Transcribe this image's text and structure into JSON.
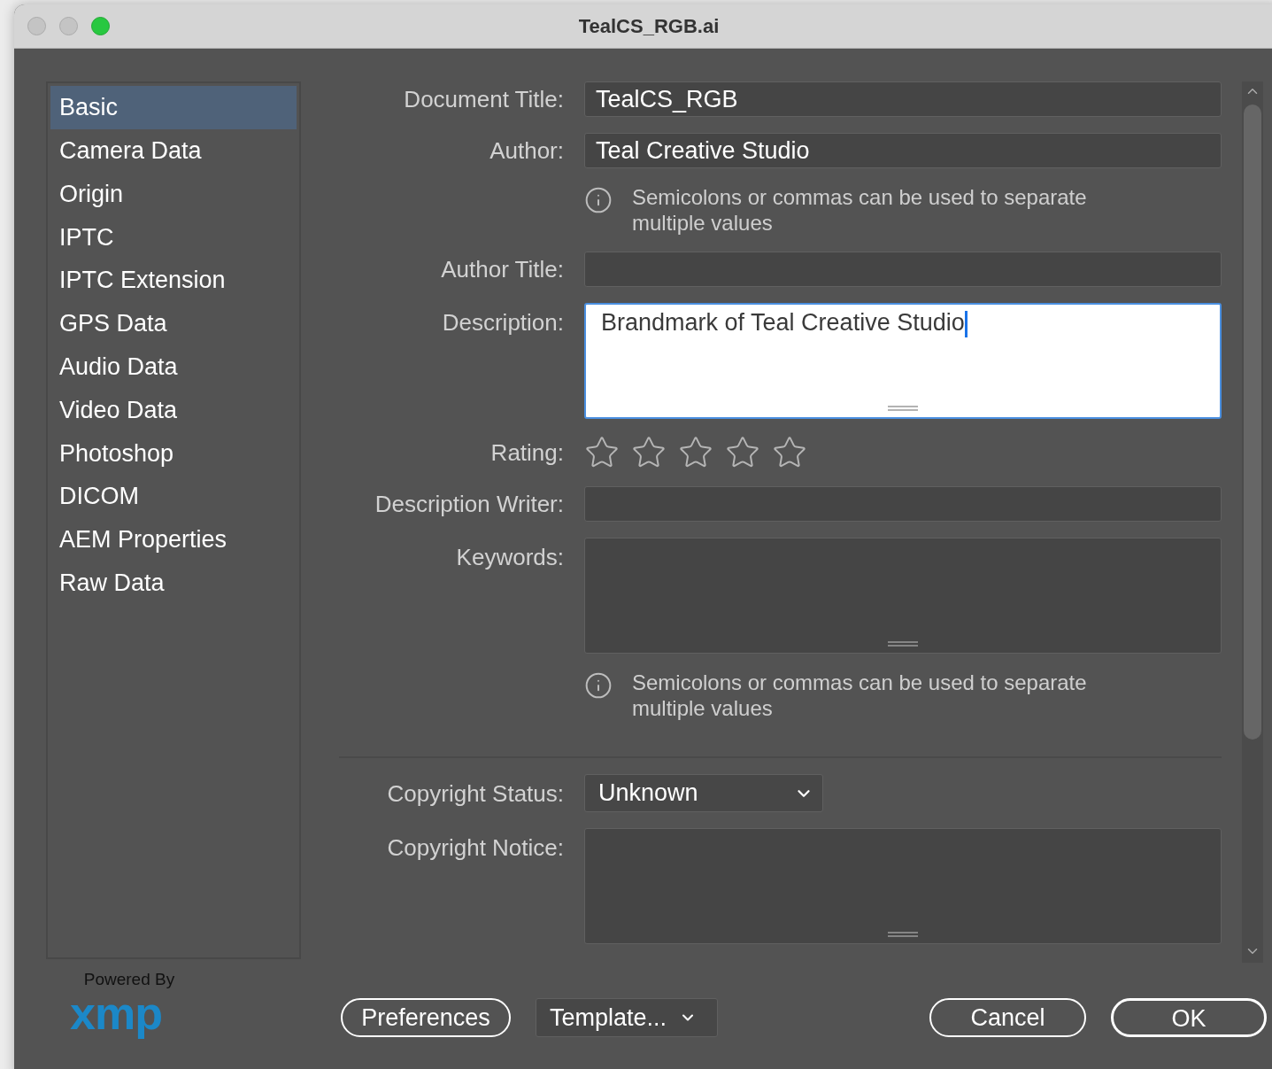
{
  "window": {
    "title": "TealCS_RGB.ai"
  },
  "sidebar": {
    "items": [
      {
        "label": "Basic",
        "selected": true
      },
      {
        "label": "Camera Data",
        "selected": false
      },
      {
        "label": "Origin",
        "selected": false
      },
      {
        "label": "IPTC",
        "selected": false
      },
      {
        "label": "IPTC Extension",
        "selected": false
      },
      {
        "label": "GPS Data",
        "selected": false
      },
      {
        "label": "Audio Data",
        "selected": false
      },
      {
        "label": "Video Data",
        "selected": false
      },
      {
        "label": "Photoshop",
        "selected": false
      },
      {
        "label": "DICOM",
        "selected": false
      },
      {
        "label": "AEM Properties",
        "selected": false
      },
      {
        "label": "Raw Data",
        "selected": false
      }
    ]
  },
  "sections": [
    {
      "fields": [
        {
          "kind": "text",
          "label": "Document Title:",
          "value": "TealCS_RGB"
        },
        {
          "kind": "text",
          "label": "Author:",
          "value": "Teal Creative Studio"
        },
        {
          "kind": "note",
          "text": "Semicolons or commas can be used to separate multiple values"
        },
        {
          "kind": "text",
          "label": "Author Title:"
        },
        {
          "kind": "textarea",
          "label": "Description:",
          "value": "Brandmark of Teal Creative Studio",
          "focused": true
        },
        {
          "kind": "rating",
          "label": "Rating:",
          "stars": 0
        },
        {
          "kind": "text",
          "label": "Description Writer:"
        },
        {
          "kind": "textarea",
          "label": "Keywords:",
          "focused": false
        },
        {
          "kind": "note",
          "text": "Semicolons or commas can be used to separate multiple values"
        }
      ]
    },
    {
      "fields": [
        {
          "kind": "select",
          "label": "Copyright Status:",
          "value": "Unknown"
        },
        {
          "kind": "textarea",
          "label": "Copyright Notice:",
          "focused": false
        }
      ]
    }
  ],
  "logo": {
    "caption": "Powered By",
    "mark": "xmp"
  },
  "buttons": [
    {
      "kind": "pill",
      "label": "Preferences"
    },
    {
      "kind": "menu",
      "label": "Template..."
    },
    {
      "kind": "spacer"
    },
    {
      "kind": "pill",
      "label": "Cancel"
    },
    {
      "kind": "default",
      "label": "OK"
    }
  ]
}
